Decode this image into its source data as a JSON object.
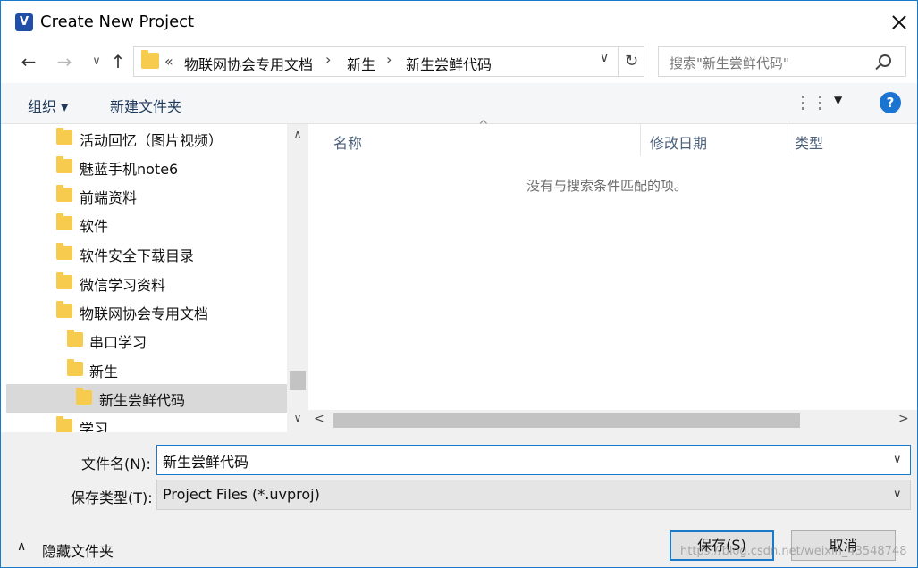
{
  "window": {
    "title": "Create New Project",
    "icon_label": "V"
  },
  "nav": {
    "back": "←",
    "forward": "→",
    "recent": "∨",
    "up": "↑"
  },
  "address": {
    "overflow": "«",
    "crumbs": [
      "物联网协会专用文档",
      "新生",
      "新生尝鲜代码"
    ],
    "separator": "›",
    "dropdown": "∨",
    "refresh": "↻"
  },
  "search": {
    "placeholder": "搜索\"新生尝鲜代码\""
  },
  "toolbar": {
    "organize_label": "组织 ▾",
    "new_folder_label": "新建文件夹",
    "view_caret": "▼",
    "help_label": "?"
  },
  "tree": {
    "items": [
      {
        "label": "活动回忆（图片视频）"
      },
      {
        "label": "魅蓝手机note6"
      },
      {
        "label": "前端资料"
      },
      {
        "label": "软件"
      },
      {
        "label": "软件安全下载目录"
      },
      {
        "label": "微信学习资料"
      },
      {
        "label": "物联网协会专用文档"
      },
      {
        "label": "串口学习"
      },
      {
        "label": "新生"
      },
      {
        "label": "新生尝鲜代码"
      },
      {
        "label": "学习"
      }
    ],
    "scroll_up": "∧",
    "scroll_down": "∨"
  },
  "files": {
    "columns": [
      "名称",
      "修改日期",
      "类型"
    ],
    "sort_indicator": "^",
    "empty_message": "没有与搜索条件匹配的项。",
    "scroll_left": "<",
    "scroll_right": ">"
  },
  "form": {
    "filename_label": "文件名(N):",
    "filename_value": "新生尝鲜代码",
    "filetype_label": "保存类型(T):",
    "filetype_value": "Project Files (*.uvproj)",
    "dropdown": "∨"
  },
  "footer": {
    "hide_folders_label": "隐藏文件夹",
    "hide_caret": "∧",
    "save_label": "保存(S)",
    "cancel_label": "取消",
    "watermark": "https://blog.csdn.net/weixin_43548748"
  }
}
